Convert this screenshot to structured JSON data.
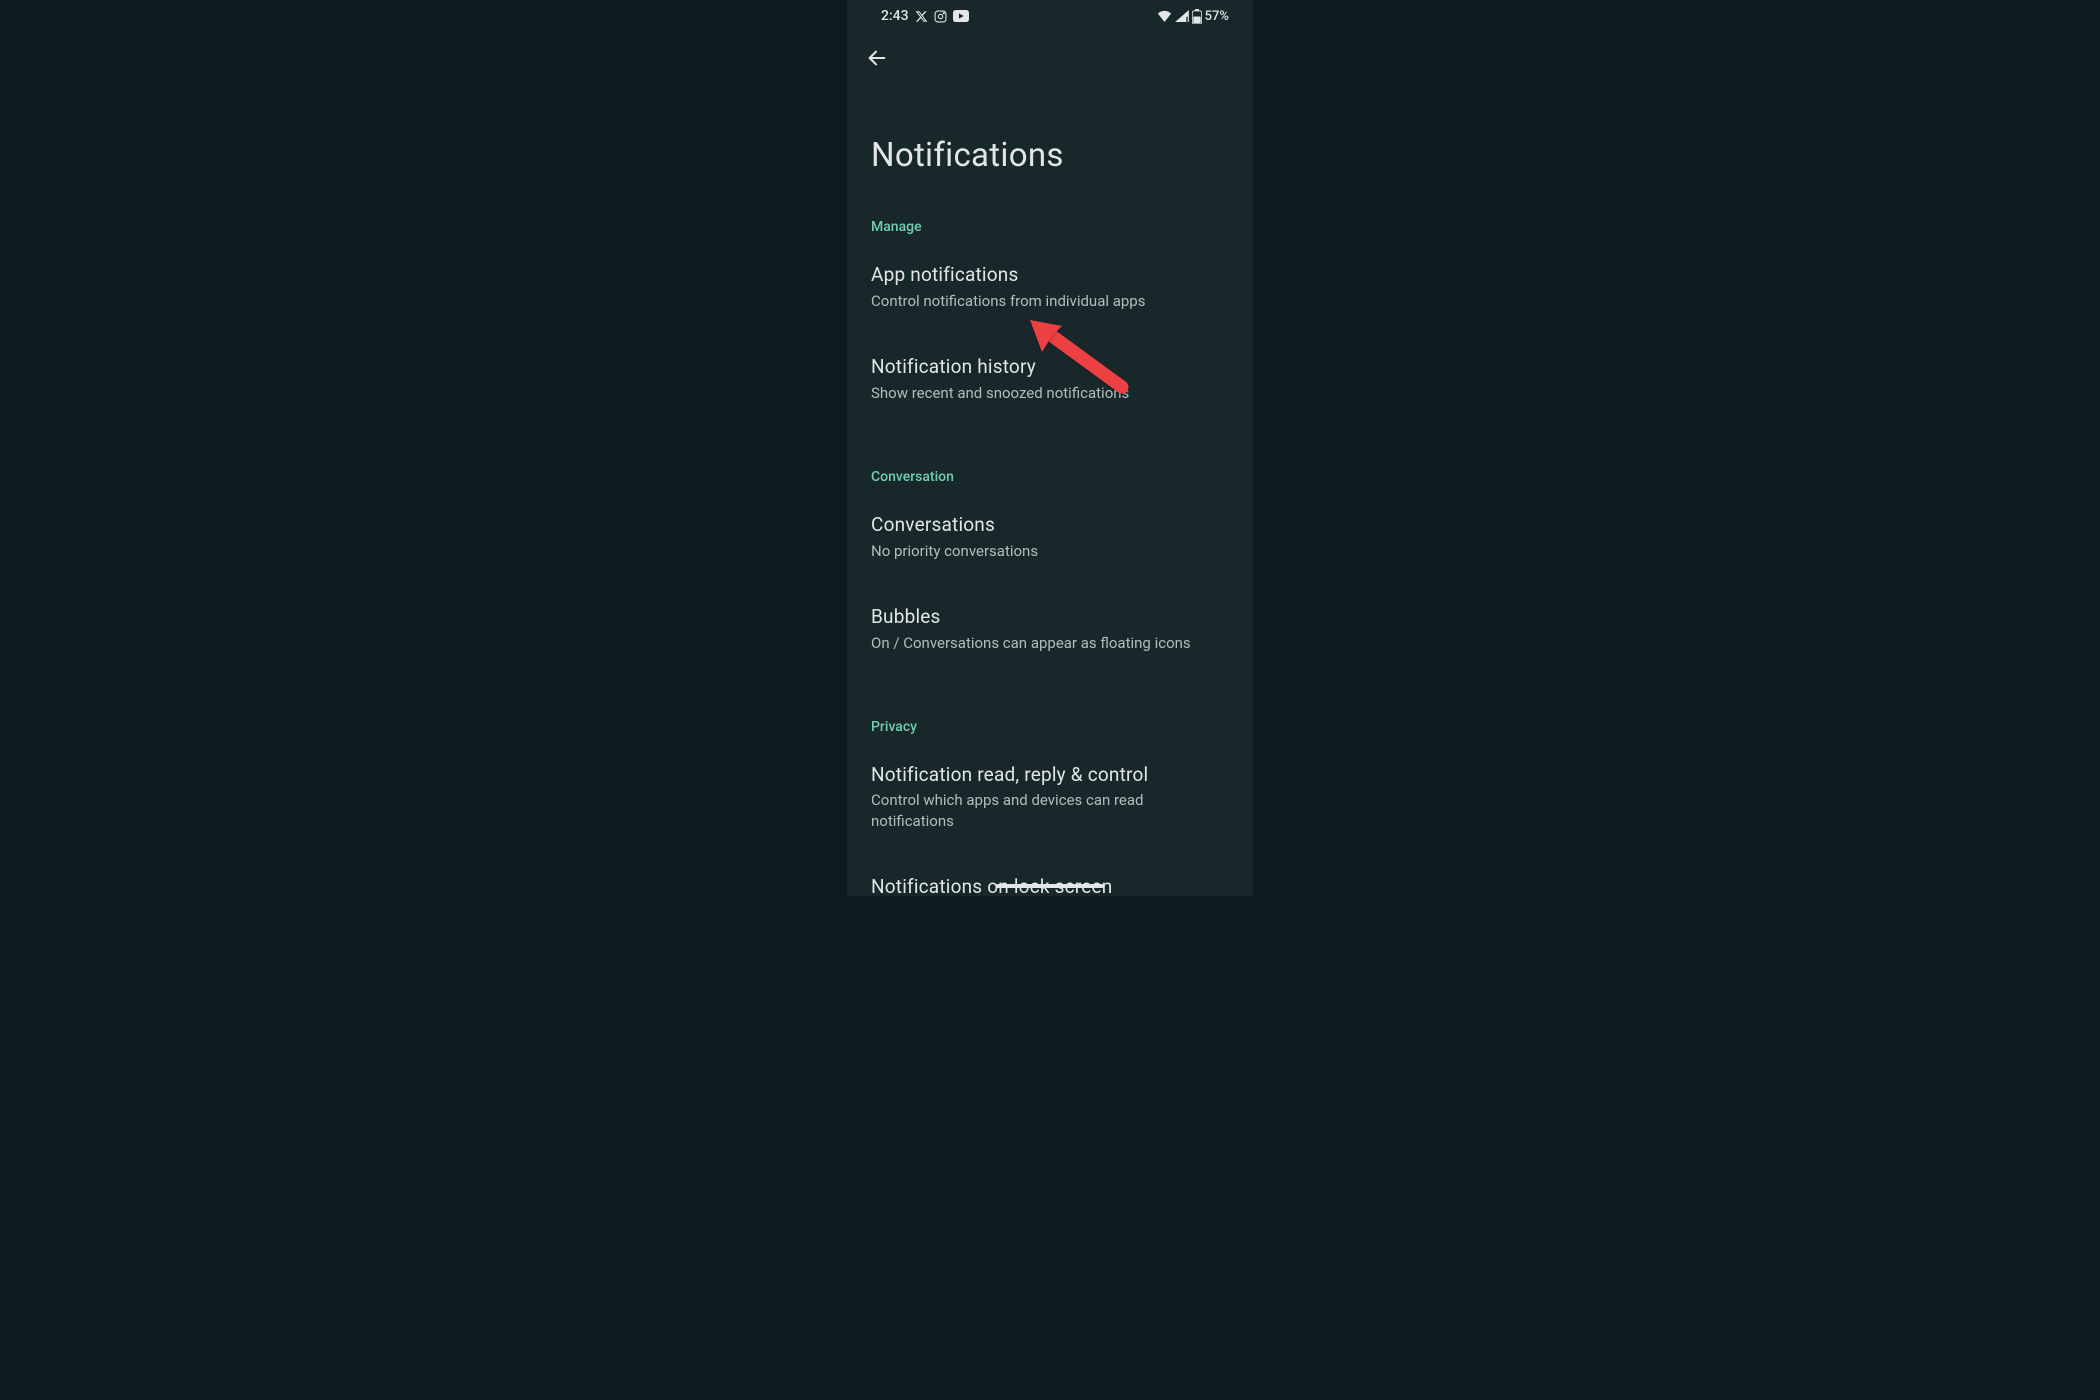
{
  "statusBar": {
    "time": "2:43",
    "battery": "57%"
  },
  "pageTitle": "Notifications",
  "sections": {
    "manage": {
      "header": "Manage",
      "items": [
        {
          "title": "App notifications",
          "subtitle": "Control notifications from individual apps"
        },
        {
          "title": "Notification history",
          "subtitle": "Show recent and snoozed notifications"
        }
      ]
    },
    "conversation": {
      "header": "Conversation",
      "items": [
        {
          "title": "Conversations",
          "subtitle": "No priority conversations"
        },
        {
          "title": "Bubbles",
          "subtitle": "On / Conversations can appear as floating icons"
        }
      ]
    },
    "privacy": {
      "header": "Privacy",
      "items": [
        {
          "title": "Notification read, reply & control",
          "subtitle": "Control which apps and devices can read notifications"
        },
        {
          "title": "Notifications on lock screen",
          "subtitle": ""
        }
      ]
    }
  }
}
